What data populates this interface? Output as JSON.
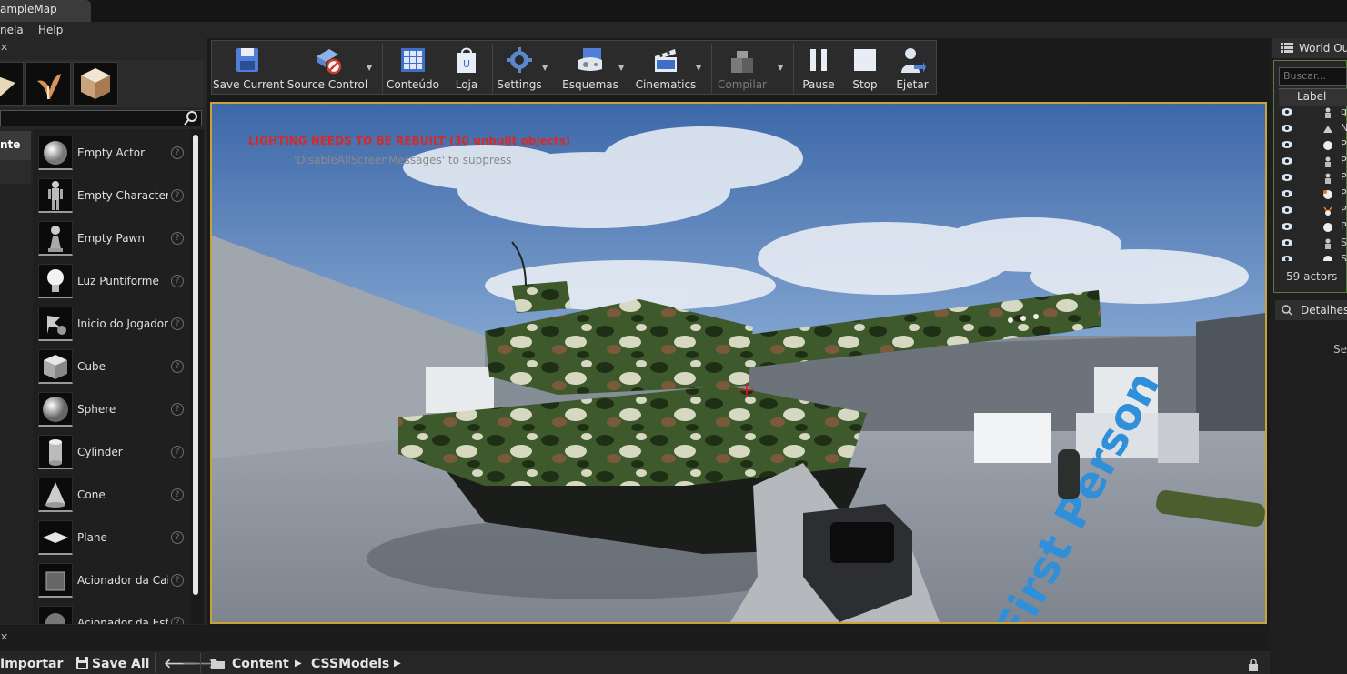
{
  "window": {
    "map_tab": "ampleMap"
  },
  "menu": {
    "items": [
      "nela",
      "Help"
    ]
  },
  "place_mode": {
    "search_placeholder": "",
    "active_category": "nte",
    "items": [
      {
        "label": "Empty Actor",
        "icon": "sphere-small-icon"
      },
      {
        "label": "Empty Character",
        "icon": "character-figure-icon"
      },
      {
        "label": "Empty Pawn",
        "icon": "pawn-icon"
      },
      {
        "label": "Luz Puntiforme",
        "icon": "light-bulb-icon"
      },
      {
        "label": "Inicio do Jogador",
        "icon": "player-start-icon"
      },
      {
        "label": "Cube",
        "icon": "cube-icon"
      },
      {
        "label": "Sphere",
        "icon": "sphere-icon"
      },
      {
        "label": "Cylinder",
        "icon": "cylinder-icon"
      },
      {
        "label": "Cone",
        "icon": "cone-icon"
      },
      {
        "label": "Plane",
        "icon": "plane-icon"
      },
      {
        "label": "Acionador da Cai",
        "icon": "box-trigger-icon"
      },
      {
        "label": "Acionador da Esf",
        "icon": "sphere-trigger-icon"
      }
    ]
  },
  "toolbar": {
    "buttons": [
      {
        "label": "Save Current",
        "icon": "save-icon"
      },
      {
        "label": "Source Control",
        "icon": "source-control-icon"
      },
      {
        "label": "Conteúdo",
        "icon": "content-browser-icon"
      },
      {
        "label": "Loja",
        "icon": "marketplace-icon"
      },
      {
        "label": "Settings",
        "icon": "settings-icon"
      },
      {
        "label": "Esquemas",
        "icon": "blueprints-icon"
      },
      {
        "label": "Cinematics",
        "icon": "cinematics-icon"
      },
      {
        "label": "Compilar",
        "icon": "build-icon",
        "disabled": true
      },
      {
        "label": "Pause",
        "icon": "pause-icon"
      },
      {
        "label": "Stop",
        "icon": "stop-icon"
      },
      {
        "label": "Ejetar",
        "icon": "eject-icon"
      }
    ]
  },
  "viewport": {
    "warning": "LIGHTING NEEDS TO BE REBUILT (30 unbuilt objects)",
    "suppress_hint": "'DisableAllScreenMessages' to suppress",
    "floor_text": "First Person"
  },
  "world_outliner": {
    "tab_label": "World Outliner",
    "search_placeholder": "Buscar...",
    "column_label": "Label",
    "rows": [
      "g",
      "N",
      "P",
      "P",
      "P",
      "P",
      "P",
      "P",
      "S",
      "S"
    ],
    "actor_count": "59 actors"
  },
  "details": {
    "tab_label": "Detalhes",
    "partial_text": "Se"
  },
  "content_browser": {
    "import_label": "Importar",
    "save_all_label": "Save All",
    "path": [
      "Content",
      "CSSModels"
    ]
  },
  "colors": {
    "viewport_border": "#c9a33a",
    "warning_red": "#d32a2a"
  }
}
